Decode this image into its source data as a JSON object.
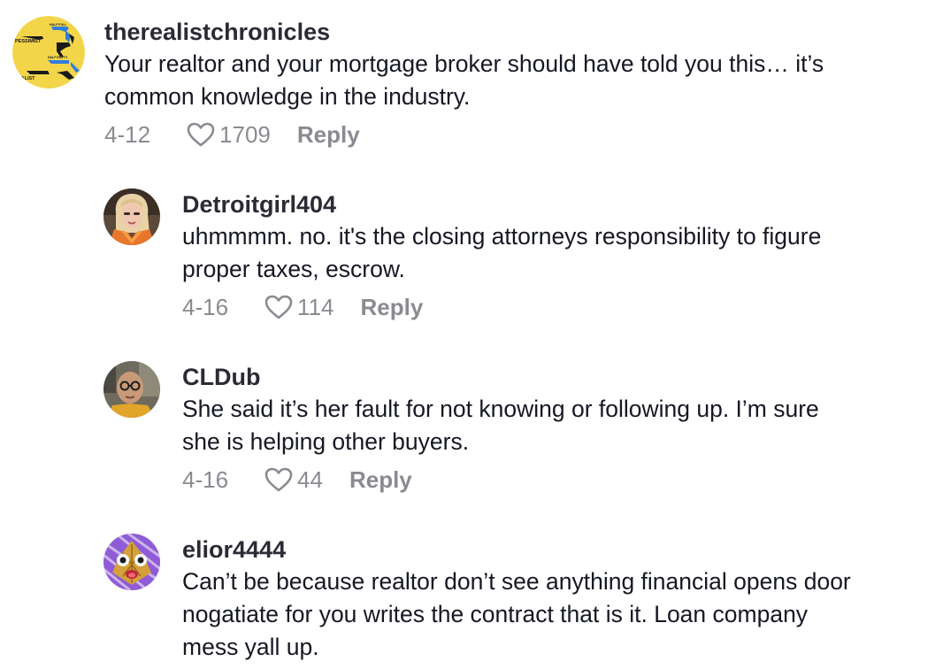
{
  "comments": [
    {
      "username": "therealistchronicles",
      "text": "Your realtor and your mortgage broker should have told you this… it’s\ncommon knowledge in the industry.",
      "date": "4-12",
      "likes": "1709",
      "reply_label": "Reply",
      "avatar": {
        "icon": "florida-map-avatar-icon",
        "lines": [
          "PESSIMIST",
          "HALF FULL",
          "HALF EMPTY",
          "REALIST"
        ],
        "background": "#f3d54a"
      }
    },
    {
      "username": "Detroitgirl404",
      "text": "uhmmmm. no. it's the closing attorneys responsibility to figure\nproper taxes, escrow.",
      "date": "4-16",
      "likes": "114",
      "reply_label": "Reply",
      "avatar": {
        "icon": "woman-portrait-avatar-icon"
      }
    },
    {
      "username": "CLDub",
      "text": "She said it’s her fault for not knowing or following up. I’m sure\nshe is helping other buyers.",
      "date": "4-16",
      "likes": "44",
      "reply_label": "Reply",
      "avatar": {
        "icon": "man-glasses-avatar-icon"
      }
    },
    {
      "username": "elior4444",
      "text": "Can’t be because realtor don’t see anything financial opens door\nnogatiate for you writes the contract that is it. Loan company\nmess yall up.",
      "avatar": {
        "icon": "purple-cartoon-avatar-icon"
      }
    }
  ],
  "colors": {
    "text": "#161823",
    "username": "#2b2b35",
    "meta": "#8a8b91"
  }
}
